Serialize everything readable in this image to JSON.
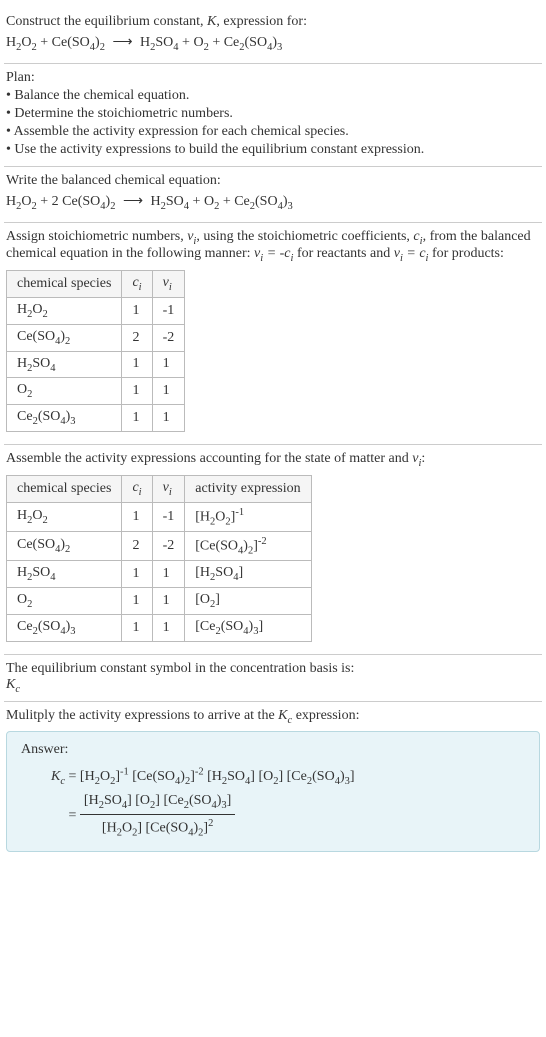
{
  "intro": {
    "line1": "Construct the equilibrium constant, ",
    "k": "K",
    "line1b": ", expression for:",
    "equation": "H₂O₂ + Ce(SO₄)₂ ⟶ H₂SO₄ + O₂ + Ce₂(SO₄)₃"
  },
  "plan": {
    "heading": "Plan:",
    "items": [
      "• Balance the chemical equation.",
      "• Determine the stoichiometric numbers.",
      "• Assemble the activity expression for each chemical species.",
      "• Use the activity expressions to build the equilibrium constant expression."
    ]
  },
  "balanced": {
    "heading": "Write the balanced chemical equation:",
    "equation": "H₂O₂ + 2 Ce(SO₄)₂ ⟶ H₂SO₄ + O₂ + Ce₂(SO₄)₃"
  },
  "stoich": {
    "heading_pre": "Assign stoichiometric numbers, ",
    "nu_i": "νᵢ",
    "heading_mid": ", using the stoichiometric coefficients, ",
    "c_i": "cᵢ",
    "heading_mid2": ", from the balanced chemical equation in the following manner: ",
    "rel_react": "νᵢ = -cᵢ",
    "heading_mid3": " for reactants and ",
    "rel_prod": "νᵢ = cᵢ",
    "heading_end": " for products:",
    "headers": {
      "species": "chemical species",
      "ci": "cᵢ",
      "nui": "νᵢ"
    },
    "rows": [
      {
        "species": "H₂O₂",
        "ci": "1",
        "nui": "-1"
      },
      {
        "species": "Ce(SO₄)₂",
        "ci": "2",
        "nui": "-2"
      },
      {
        "species": "H₂SO₄",
        "ci": "1",
        "nui": "1"
      },
      {
        "species": "O₂",
        "ci": "1",
        "nui": "1"
      },
      {
        "species": "Ce₂(SO₄)₃",
        "ci": "1",
        "nui": "1"
      }
    ]
  },
  "activity": {
    "heading_pre": "Assemble the activity expressions accounting for the state of matter and ",
    "nu_i": "νᵢ",
    "heading_end": ":",
    "headers": {
      "species": "chemical species",
      "ci": "cᵢ",
      "nui": "νᵢ",
      "expr": "activity expression"
    },
    "rows": [
      {
        "species": "H₂O₂",
        "ci": "1",
        "nui": "-1",
        "expr": "[H₂O₂]⁻¹"
      },
      {
        "species": "Ce(SO₄)₂",
        "ci": "2",
        "nui": "-2",
        "expr": "[Ce(SO₄)₂]⁻²"
      },
      {
        "species": "H₂SO₄",
        "ci": "1",
        "nui": "1",
        "expr": "[H₂SO₄]"
      },
      {
        "species": "O₂",
        "ci": "1",
        "nui": "1",
        "expr": "[O₂]"
      },
      {
        "species": "Ce₂(SO₄)₃",
        "ci": "1",
        "nui": "1",
        "expr": "[Ce₂(SO₄)₃]"
      }
    ]
  },
  "kcsymbol": {
    "heading": "The equilibrium constant symbol in the concentration basis is:",
    "symbol": "K_c"
  },
  "multiply": {
    "heading_pre": "Mulitply the activity expressions to arrive at the ",
    "kc": "K_c",
    "heading_end": " expression:"
  },
  "answer": {
    "label": "Answer:",
    "kc_eq": "K_c",
    "line1": " = [H₂O₂]⁻¹ [Ce(SO₄)₂]⁻² [H₂SO₄] [O₂] [Ce₂(SO₄)₃]",
    "eq2": " = ",
    "num": "[H₂SO₄] [O₂] [Ce₂(SO₄)₃]",
    "den": "[H₂O₂] [Ce(SO₄)₂]²"
  }
}
